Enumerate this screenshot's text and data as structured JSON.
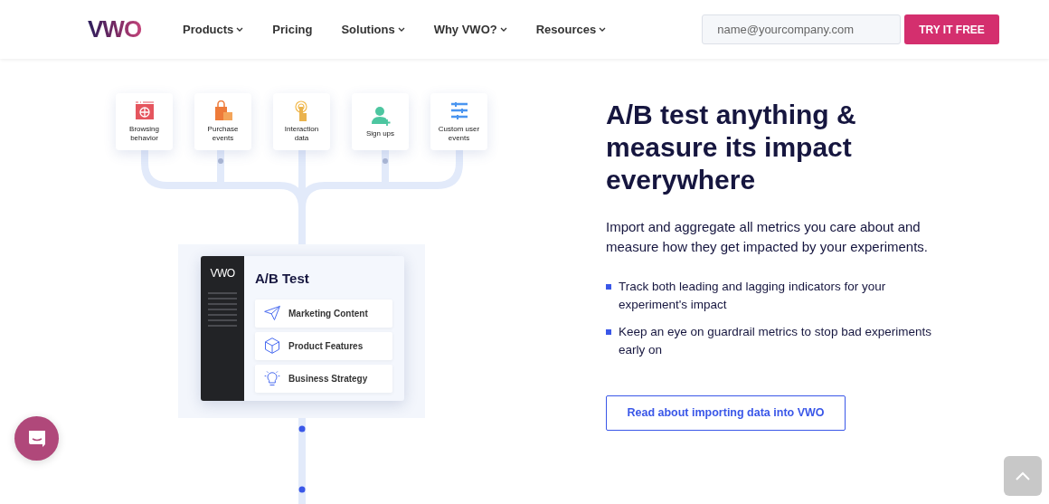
{
  "logo": "VWO",
  "nav": [
    {
      "label": "Products",
      "dropdown": true
    },
    {
      "label": "Pricing",
      "dropdown": false
    },
    {
      "label": "Solutions",
      "dropdown": true
    },
    {
      "label": "Why VWO?",
      "dropdown": true
    },
    {
      "label": "Resources",
      "dropdown": true
    }
  ],
  "email": {
    "placeholder": "name@yourcompany.com"
  },
  "cta": "TRY IT FREE",
  "sources": [
    {
      "label": "Browsing behavior",
      "kind": "globe"
    },
    {
      "label": "Purchase events",
      "kind": "bag"
    },
    {
      "label": "Interaction data",
      "kind": "tap"
    },
    {
      "label": "Sign ups",
      "kind": "user"
    },
    {
      "label": "Custom user events",
      "kind": "sliders"
    }
  ],
  "test_card": {
    "logo": "VWO",
    "title": "A/B Test",
    "items": [
      {
        "label": "Marketing Content",
        "kind": "plane"
      },
      {
        "label": "Product Features",
        "kind": "box"
      },
      {
        "label": "Business Strategy",
        "kind": "bulb"
      }
    ]
  },
  "heading": "A/B test anything & measure its impact everywhere",
  "intro": "Import and aggregate all metrics you care about and measure how they get impacted by your experiments.",
  "bullets": [
    "Track both leading and lagging indicators for your experiment's impact",
    "Keep an eye on guardrail metrics to stop bad experiments early on"
  ],
  "link_button": "Read about importing data into VWO"
}
